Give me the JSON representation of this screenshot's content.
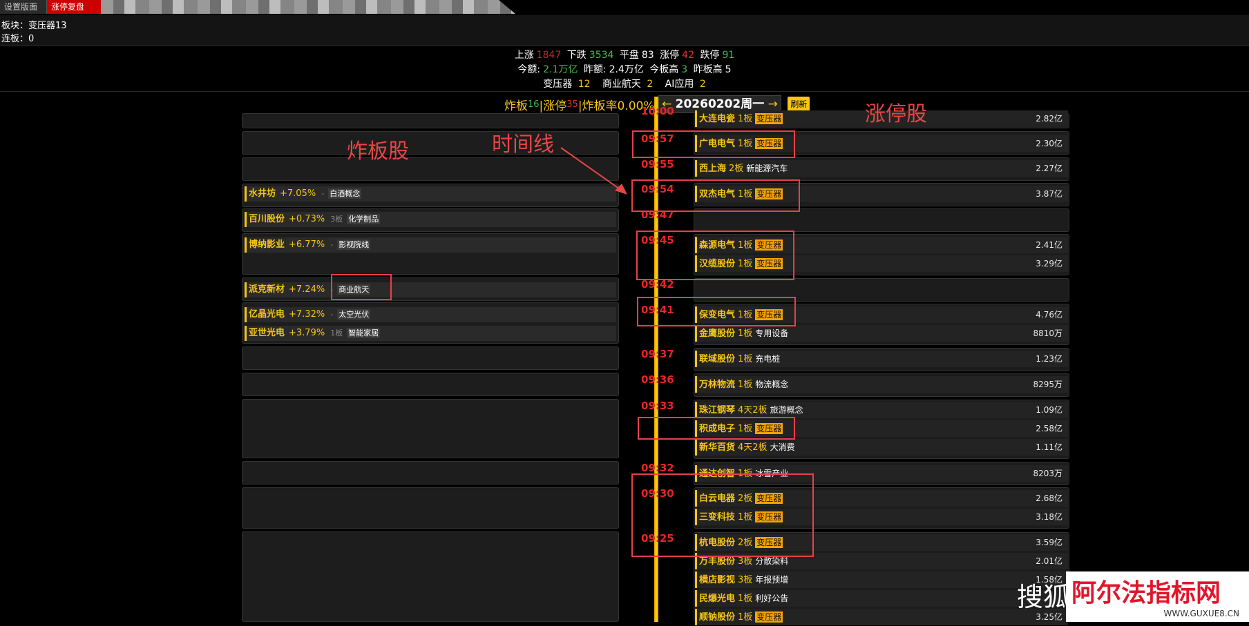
{
  "tabs": [
    {
      "label": "设置版面"
    },
    {
      "label": "涨停复盘"
    }
  ],
  "info": {
    "sector": "板块：变压器13",
    "streak": "连板：0"
  },
  "stats": {
    "rise_label": "上涨",
    "rise": "1847",
    "fall_label": "下跌",
    "fall": "3534",
    "flat_label": "平盘",
    "flat": "83",
    "limitup_label": "涨停",
    "limitup": "42",
    "limitdown_label": "跌停",
    "limitdown": "91",
    "today_label": "今额:",
    "today": "2.1万亿",
    "yest_label": "昨额:",
    "yest": "2.4万亿",
    "today_high_label": "今板高",
    "today_high": "3",
    "yest_high_label": "昨板高",
    "yest_high": "5",
    "sectors": [
      {
        "name": "变压器",
        "count": "12"
      },
      {
        "name": "商业航天",
        "count": "2"
      },
      {
        "name": "AI应用",
        "count": "2"
      }
    ]
  },
  "controls": {
    "broken_label": "炸板",
    "broken": "16",
    "limitup_label": "|涨停",
    "limitup": "35",
    "rate_label": "|炸板率0.00%",
    "arrow_left": "←",
    "date": "20260202周一",
    "arrow_right": "→",
    "refresh": "刷新"
  },
  "annotations": {
    "broken_stocks": "炸板股",
    "timeline": "时间线",
    "limitup_stocks": "涨停股"
  },
  "left_items": [
    {
      "name": "水井坊",
      "pct": "+7.05%",
      "board": "-",
      "tag": "白酒概念"
    },
    {
      "name": "百川股份",
      "pct": "+0.73%",
      "board": "3板",
      "tag": "化学制品"
    },
    {
      "name": "博纳影业",
      "pct": "+6.77%",
      "board": "-",
      "tag": "影视院线"
    },
    {
      "name": "派克新材",
      "pct": "+7.24%",
      "board": "-",
      "tag": "商业航天"
    },
    {
      "name": "亿晶光电",
      "pct": "+7.32%",
      "board": "-",
      "tag": "太空光伏"
    },
    {
      "name": "亚世光电",
      "pct": "+3.79%",
      "board": "1板",
      "tag": "智能家居"
    }
  ],
  "times": [
    "10:00",
    "09:57",
    "09:55",
    "09:54",
    "09:47",
    "09:45",
    "09:42",
    "09:41",
    "09:37",
    "09:36",
    "09:33",
    "09:32",
    "09:30",
    "09:25"
  ],
  "right_items": [
    {
      "name": "大连电瓷",
      "board": "1板",
      "tag": "变压器",
      "amount": "2.82亿"
    },
    {
      "name": "广电电气",
      "board": "1板",
      "tag": "变压器",
      "amount": "2.30亿"
    },
    {
      "name": "西上海",
      "board": "2板",
      "tag": "新能源汽车",
      "amount": "2.27亿"
    },
    {
      "name": "双杰电气",
      "board": "1板",
      "tag": "变压器",
      "amount": "3.87亿"
    },
    {
      "name": "森源电气",
      "board": "1板",
      "tag": "变压器",
      "amount": "2.41亿"
    },
    {
      "name": "汉缆股份",
      "board": "1板",
      "tag": "变压器",
      "amount": "3.29亿"
    },
    {
      "name": "保变电气",
      "board": "1板",
      "tag": "变压器",
      "amount": "4.76亿"
    },
    {
      "name": "金鹰股份",
      "board": "1板",
      "tag": "专用设备",
      "amount": "8810万"
    },
    {
      "name": "联域股份",
      "board": "1板",
      "tag": "充电桩",
      "amount": "1.23亿"
    },
    {
      "name": "万林物流",
      "board": "1板",
      "tag": "物流概念",
      "amount": "8295万"
    },
    {
      "name": "珠江钢琴",
      "board": "4天2板",
      "tag": "旅游概念",
      "amount": "1.09亿"
    },
    {
      "name": "积成电子",
      "board": "1板",
      "tag": "变压器",
      "amount": "2.58亿"
    },
    {
      "name": "新华百货",
      "board": "4天2板",
      "tag": "大消费",
      "amount": "1.11亿"
    },
    {
      "name": "通达创智",
      "board": "1板",
      "tag": "冰雪产业",
      "amount": "8203万"
    },
    {
      "name": "白云电器",
      "board": "2板",
      "tag": "变压器",
      "amount": "2.68亿"
    },
    {
      "name": "三变科技",
      "board": "1板",
      "tag": "变压器",
      "amount": "3.18亿"
    },
    {
      "name": "杭电股份",
      "board": "2板",
      "tag": "变压器",
      "amount": "3.59亿"
    },
    {
      "name": "万丰股份",
      "board": "3板",
      "tag": "分散染料",
      "amount": "2.01亿"
    },
    {
      "name": "横店影视",
      "board": "3板",
      "tag": "年报预增",
      "amount": "1.58亿"
    },
    {
      "name": "民爆光电",
      "board": "1板",
      "tag": "利好公告",
      "amount": ""
    },
    {
      "name": "顺钠股份",
      "board": "1板",
      "tag": "变压器",
      "amount": "3.25亿"
    }
  ],
  "watermark": {
    "left": "搜狐",
    "right": "阿尔法指标网",
    "url": "WWW.GUXUE8.CN"
  }
}
